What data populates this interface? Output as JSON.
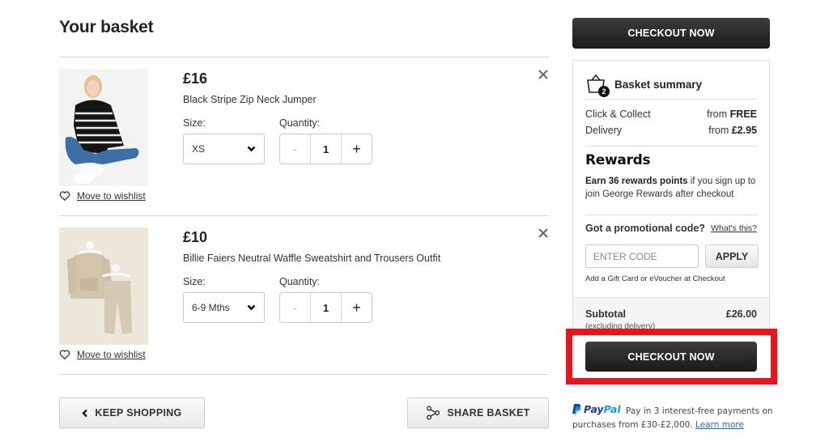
{
  "page": {
    "title": "Your basket"
  },
  "basket": {
    "items": [
      {
        "price": "£16",
        "name": "Black Stripe Zip Neck Jumper",
        "size_label": "Size:",
        "size_value": "XS",
        "quantity_label": "Quantity:",
        "quantity": "1",
        "minus": "-",
        "plus": "+",
        "wishlist_label": "Move to wishlist",
        "image_alt": "Woman sitting wearing black and white striped zip neck jumper and blue jeans"
      },
      {
        "price": "£10",
        "name": "Billie Faiers Neutral Waffle Sweatshirt and Trousers Outfit",
        "size_label": "Size:",
        "size_value": "6-9 Mths",
        "quantity_label": "Quantity:",
        "quantity": "1",
        "minus": "-",
        "plus": "+",
        "wishlist_label": "Move to wishlist",
        "image_alt": "Beige waffle sweatshirt and trousers on hangers"
      }
    ],
    "keep_shopping_label": "KEEP SHOPPING",
    "share_basket_label": "SHARE BASKET"
  },
  "summary": {
    "checkout_top_label": "CHECKOUT NOW",
    "title": "Basket summary",
    "item_count": "2",
    "delivery_rows": [
      {
        "label": "Click & Collect",
        "prefix": "from",
        "value": "FREE"
      },
      {
        "label": "Delivery",
        "prefix": "from",
        "value": "£2.95"
      }
    ],
    "rewards": {
      "title": "Rewards",
      "bold_text": "Earn 36 rewards points",
      "text": " if you sign up to join George Rewards after checkout"
    },
    "promo": {
      "question": "Got a promotional code?",
      "whats_this": "What's this?",
      "placeholder": "ENTER CODE",
      "value": "",
      "apply_label": "APPLY",
      "gift_note": "Add a Gift Card or eVoucher at Checkout"
    },
    "subtotal_label": "Subtotal",
    "subtotal_value": "£26.00",
    "subtotal_note": "(excluding delivery)",
    "checkout_bottom_label": "CHECKOUT NOW"
  },
  "paypal": {
    "brand_pay": "Pay",
    "brand_pal": "Pal",
    "text": "Pay in 3 interest-free payments on purchases from £30-£2,000.",
    "link": "Learn more"
  },
  "colors": {
    "highlight": "#e8141e",
    "checkout_button": "#222222",
    "paypal_dark": "#253b80",
    "paypal_light": "#179bd7"
  }
}
